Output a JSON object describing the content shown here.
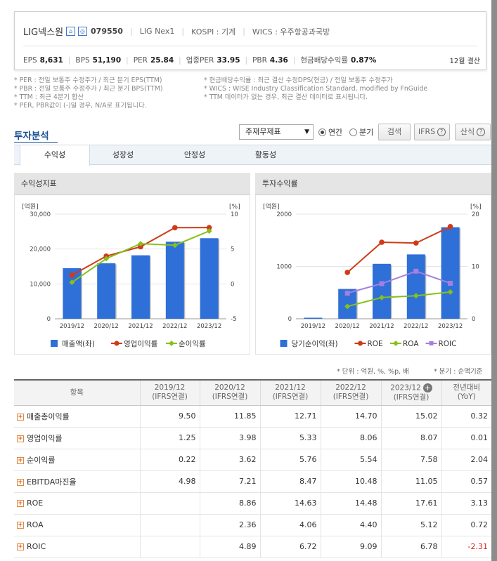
{
  "header": {
    "company": "LIG넥스원",
    "icon1": "home-icon",
    "icon2": "report-icon",
    "code": "079550",
    "eng_name": "LIG Nex1",
    "market": "KOSPI : 기계",
    "wics": "WICS : 우주항공과국방",
    "stats": [
      {
        "label": "EPS",
        "value": "8,631"
      },
      {
        "label": "BPS",
        "value": "51,190"
      },
      {
        "label": "PER",
        "value": "25.84"
      },
      {
        "label": "업종PER",
        "value": "33.95"
      },
      {
        "label": "PBR",
        "value": "4.36"
      },
      {
        "label": "현금배당수익률",
        "value": "0.87%"
      }
    ],
    "fiscal": "12월 결산"
  },
  "notes": {
    "left": [
      "* PER : 전일 보통주 수정주가 / 최근 분기 EPS(TTM)",
      "* PBR : 전일 보통주 수정주가 / 최근 분기 BPS(TTM)",
      "* TTM : 최근 4분기 합산",
      "* PER, PBR값이 (-)일 경우, N/A로 표기됩니다."
    ],
    "right": [
      "* 현금배당수익률 : 최근 결산 수정DPS(현금) / 전일 보통주 수정주가",
      "* WICS : WISE Industry Classification Standard, modified by FnGuide",
      "* TTM 데이터가 없는 경우, 최근 결산 데이터로 표시됩니다."
    ]
  },
  "toolbar": {
    "title": "투자분석",
    "select": "주재무제표",
    "radio_annual": "연간",
    "radio_quarter": "분기",
    "search": "검색",
    "ifrs": "IFRS",
    "formula": "산식"
  },
  "tabs": [
    "수익성",
    "성장성",
    "안정성",
    "활동성"
  ],
  "charts": {
    "left_title": "수익성지표",
    "right_title": "투자수익률"
  },
  "chart_data": [
    {
      "type": "bar",
      "title": "수익성지표",
      "categories": [
        "2019/12",
        "2020/12",
        "2021/12",
        "2022/12",
        "2023/12"
      ],
      "left_unit": "[억원]",
      "right_unit": "[%]",
      "ylim_left": [
        0,
        30000
      ],
      "yticks_left": [
        "0",
        "10,000",
        "20,000",
        "30,000"
      ],
      "ylim_right": [
        -5,
        10
      ],
      "yticks_right": [
        "-5",
        "0",
        "5",
        "10"
      ],
      "bars": {
        "name": "매출액(좌)",
        "color": "#2f6fd8",
        "values": [
          14500,
          15900,
          18200,
          22100,
          23100
        ]
      },
      "lines": [
        {
          "name": "영업이익률",
          "color": "#cf3b17",
          "values": [
            1.25,
            3.98,
            5.33,
            8.06,
            8.07
          ]
        },
        {
          "name": "순이익률",
          "color": "#86c11a",
          "values": [
            0.22,
            3.62,
            5.76,
            5.54,
            7.58
          ]
        }
      ]
    },
    {
      "type": "bar",
      "title": "투자수익률",
      "categories": [
        "2019/12",
        "2020/12",
        "2021/12",
        "2022/12",
        "2023/12"
      ],
      "left_unit": "[억원]",
      "right_unit": "[%]",
      "ylim_left": [
        0,
        2000
      ],
      "yticks_left": [
        "0",
        "1000",
        "2000"
      ],
      "ylim_right": [
        0,
        20
      ],
      "yticks_right": [
        "0",
        "10",
        "20"
      ],
      "bars": {
        "name": "당기순이익(좌)",
        "color": "#2f6fd8",
        "values": [
          20,
          570,
          1050,
          1230,
          1750
        ]
      },
      "lines": [
        {
          "name": "ROE",
          "color": "#cf3b17",
          "values": [
            null,
            8.86,
            14.63,
            14.48,
            17.61
          ]
        },
        {
          "name": "ROA",
          "color": "#86c11a",
          "values": [
            null,
            2.36,
            4.06,
            4.4,
            5.12
          ]
        },
        {
          "name": "ROIC",
          "color": "#a57fe0",
          "values": [
            null,
            4.89,
            6.72,
            9.09,
            6.78
          ]
        }
      ]
    }
  ],
  "table": {
    "unit_note": "* 단위 : 억원, %, %p, 배",
    "quarter_note": "* 분기 : 순액기준",
    "headers": [
      {
        "l1": "항목",
        "l2": ""
      },
      {
        "l1": "2019/12",
        "l2": "(IFRS연결)"
      },
      {
        "l1": "2020/12",
        "l2": "(IFRS연결)"
      },
      {
        "l1": "2021/12",
        "l2": "(IFRS연결)"
      },
      {
        "l1": "2022/12",
        "l2": "(IFRS연결)"
      },
      {
        "l1": "2023/12",
        "l2": "(IFRS연결)"
      },
      {
        "l1": "전년대비",
        "l2": "(YoY)"
      }
    ],
    "rows": [
      {
        "name": "매출총이익률",
        "v": [
          "9.50",
          "11.85",
          "12.71",
          "14.70",
          "15.02",
          "0.32"
        ]
      },
      {
        "name": "영업이익률",
        "v": [
          "1.25",
          "3.98",
          "5.33",
          "8.06",
          "8.07",
          "0.01"
        ]
      },
      {
        "name": "순이익률",
        "v": [
          "0.22",
          "3.62",
          "5.76",
          "5.54",
          "7.58",
          "2.04"
        ]
      },
      {
        "name": "EBITDA마진율",
        "v": [
          "4.98",
          "7.21",
          "8.47",
          "10.48",
          "11.05",
          "0.57"
        ]
      },
      {
        "name": "ROE",
        "v": [
          "",
          "8.86",
          "14.63",
          "14.48",
          "17.61",
          "3.13"
        ]
      },
      {
        "name": "ROA",
        "v": [
          "",
          "2.36",
          "4.06",
          "4.40",
          "5.12",
          "0.72"
        ]
      },
      {
        "name": "ROIC",
        "v": [
          "",
          "4.89",
          "6.72",
          "9.09",
          "6.78",
          "-2.31"
        ]
      }
    ]
  }
}
